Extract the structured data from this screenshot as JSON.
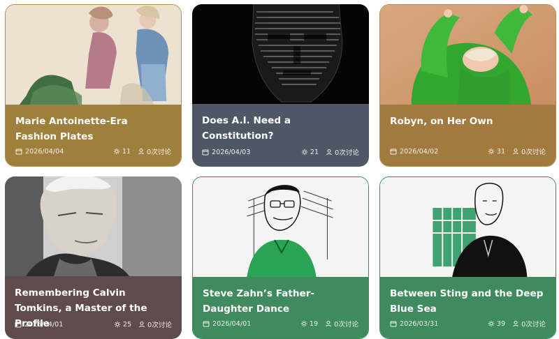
{
  "cards": [
    {
      "title": "Marie Antoinette-Era Fashion Plates",
      "date": "2026/04/04",
      "views": "11",
      "comments": "0次讨论",
      "bg": "#9e7f3c"
    },
    {
      "title": "Does A.I. Need a Constitution?",
      "date": "2026/04/03",
      "views": "21",
      "comments": "0次讨论",
      "bg": "#4f5766"
    },
    {
      "title": "Robyn, on Her Own",
      "date": "2026/04/02",
      "views": "31",
      "comments": "0次讨论",
      "bg": "#a27a3f"
    },
    {
      "title": "Remembering Calvin Tomkins, a Master of the Profile",
      "date": "2026/04/01",
      "views": "25",
      "comments": "0次讨论",
      "bg": "#5f4b4b"
    },
    {
      "title": "Steve Zahn’s Father-Daughter Dance",
      "date": "2026/04/01",
      "views": "19",
      "comments": "0次讨论",
      "bg": "#3f8a5e"
    },
    {
      "title": "Between Sting and the Deep Blue Sea",
      "date": "2026/03/31",
      "views": "39",
      "comments": "0次讨论",
      "bg": "#3f8a5e"
    }
  ],
  "icons": {
    "date": "calendar-icon",
    "views": "sun-icon",
    "comments": "user-icon"
  }
}
